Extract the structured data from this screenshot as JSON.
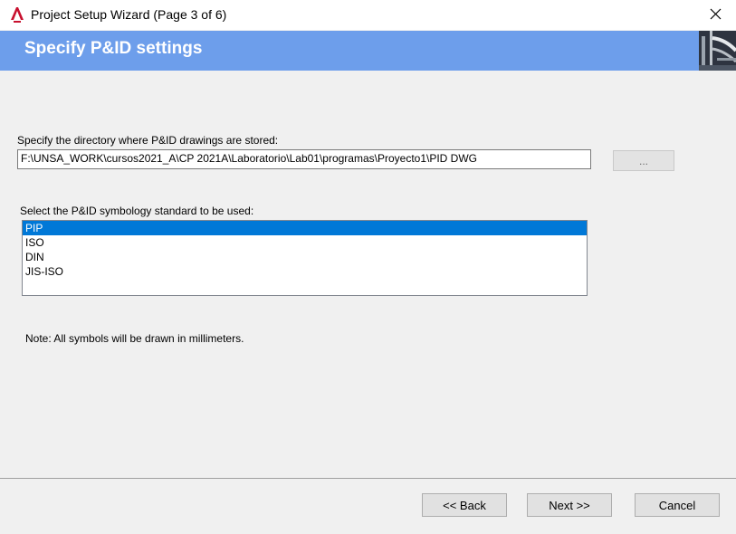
{
  "window": {
    "title": "Project Setup Wizard (Page 3 of 6)",
    "app_icon": "autocad-plant-logo-icon",
    "close_icon": "close-icon"
  },
  "banner": {
    "title": "Specify P&ID settings",
    "background_color": "#6d9eeb"
  },
  "directory": {
    "label": "Specify the directory where P&ID drawings are stored:",
    "value": "F:\\UNSA_WORK\\cursos2021_A\\CP 2021A\\Laboratorio\\Lab01\\programas\\Proyecto1\\PID DWG",
    "browse_label": "..."
  },
  "symbology": {
    "label": "Select the P&ID symbology standard to be used:",
    "options": [
      "PIP",
      "ISO",
      "DIN",
      "JIS-ISO"
    ],
    "selected": "PIP",
    "selection_color": "#0078d7"
  },
  "note": "Note: All symbols will be drawn in millimeters.",
  "buttons": {
    "back": "<< Back",
    "next": "Next >>",
    "cancel": "Cancel"
  }
}
